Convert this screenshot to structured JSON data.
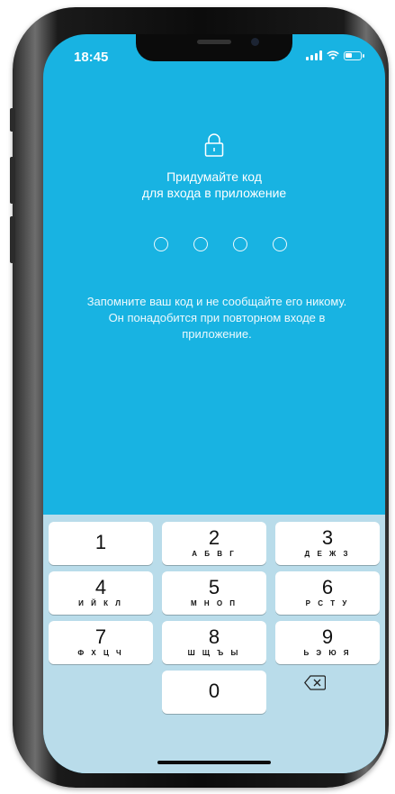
{
  "status": {
    "time": "18:45"
  },
  "header": {
    "line1": "Придумайте код",
    "line2": "для входа в приложение"
  },
  "pin": {
    "length": 4,
    "filled": 0
  },
  "hint": "Запомните ваш код и не сообщайте его никому. Он понадобится при повторном входе в приложение.",
  "keypad": {
    "k1": {
      "num": "1",
      "letters": ""
    },
    "k2": {
      "num": "2",
      "letters": "А Б В Г"
    },
    "k3": {
      "num": "3",
      "letters": "Д Е Ж З"
    },
    "k4": {
      "num": "4",
      "letters": "И Й К Л"
    },
    "k5": {
      "num": "5",
      "letters": "М Н О П"
    },
    "k6": {
      "num": "6",
      "letters": "Р С Т У"
    },
    "k7": {
      "num": "7",
      "letters": "Ф Х Ц Ч"
    },
    "k8": {
      "num": "8",
      "letters": "Ш Щ Ъ Ы"
    },
    "k9": {
      "num": "9",
      "letters": "Ь Э Ю Я"
    },
    "k0": {
      "num": "0",
      "letters": ""
    },
    "delete_icon": "backspace-icon"
  },
  "colors": {
    "background": "#18b3e2",
    "keyboard": "#b9dcea"
  }
}
